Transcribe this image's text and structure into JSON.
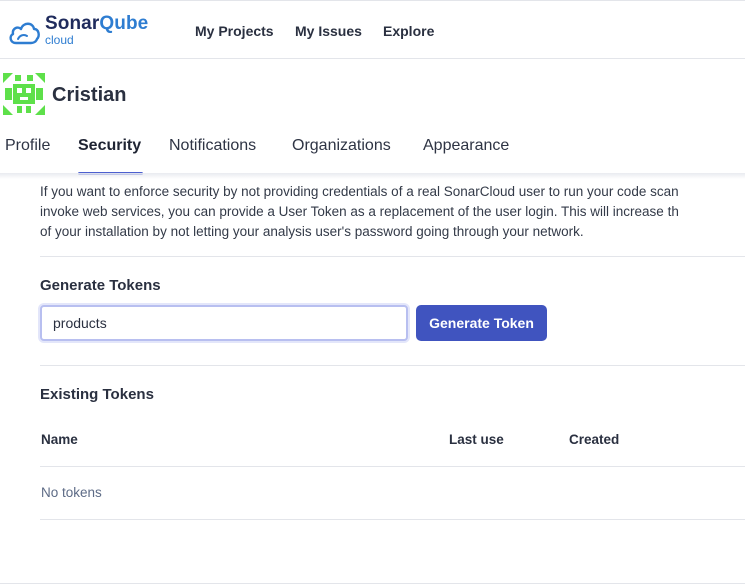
{
  "brand": {
    "name_prefix": "Sonar",
    "name_suffix": "Qube",
    "sub": "cloud",
    "icon": "sonar-cloud-logo-icon"
  },
  "topnav": {
    "links": [
      "My Projects",
      "My Issues",
      "Explore"
    ]
  },
  "user": {
    "name": "Cristian",
    "avatar_icon": "identicon-avatar-icon"
  },
  "tabs": {
    "items": [
      "Profile",
      "Security",
      "Notifications",
      "Organizations",
      "Appearance"
    ],
    "active": "Security"
  },
  "description": {
    "lines": [
      "If you want to enforce security by not providing credentials of a real SonarCloud user to run your code scan",
      "invoke web services, you can provide a User Token as a replacement of the user login. This will increase th",
      "of your installation by not letting your analysis user's password going through your network."
    ]
  },
  "generate": {
    "title": "Generate Tokens",
    "input_value": "products",
    "button_label": "Generate Token"
  },
  "existing": {
    "title": "Existing Tokens",
    "columns": [
      "Name",
      "Last use",
      "Created"
    ],
    "empty_text": "No tokens"
  },
  "colors": {
    "accent": "#4054bf",
    "tab_underline": "#4c5fcf",
    "avatar_green": "#5ee04a",
    "brand_blue": "#2e7dd1"
  }
}
